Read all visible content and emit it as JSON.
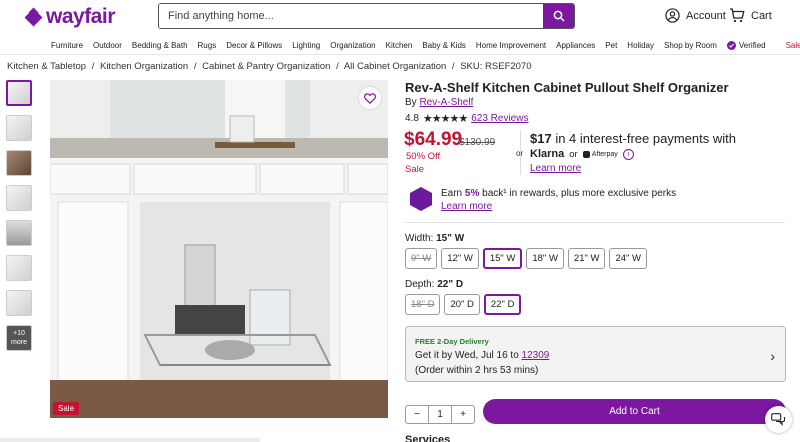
{
  "header": {
    "brand": "wayfair",
    "search_placeholder": "Find anything home...",
    "account_label": "Account",
    "cart_label": "Cart"
  },
  "nav": [
    "Furniture",
    "Outdoor",
    "Bedding & Bath",
    "Rugs",
    "Decor & Pillows",
    "Lighting",
    "Organization",
    "Kitchen",
    "Baby & Kids",
    "Home Improvement",
    "Appliances",
    "Pet",
    "Holiday",
    "Shop by Room"
  ],
  "nav_verified": "Verified",
  "nav_sale": "Sale",
  "breadcrumbs": [
    "Kitchen & Tabletop",
    "/",
    "Kitchen Organization",
    "/",
    "Cabinet & Pantry Organization",
    "/",
    "All Cabinet Organization",
    "/",
    "SKU: RSEF2070"
  ],
  "gallery": {
    "more_label": "+10 more",
    "sale_badge": "Sale"
  },
  "product": {
    "title": "Rev-A-Shelf Kitchen Cabinet Pullout Shelf Organizer",
    "by_prefix": "By",
    "brand": "Rev-A-Shelf",
    "rating": "4.8",
    "stars": "★★★★★",
    "reviews": "623 Reviews",
    "price": "$64.99",
    "old_price": "$130.99",
    "pct_off": "50% Off",
    "sale_label": "Sale",
    "or_label": "or",
    "installment_amount": "$17",
    "installment_text": " in 4 interest-free payments with",
    "klarna": "Klarna",
    "or2": "or",
    "afterpay": "Afterpay",
    "learn_more": "Learn more"
  },
  "rewards": {
    "earn": "Earn",
    "pct": "5%",
    "rest": " back¹ in rewards, plus more exclusive perks",
    "learn_more": "Learn more"
  },
  "width": {
    "label": "Width:",
    "value": "15\" W",
    "options": [
      "9\" W",
      "12\" W",
      "15\" W",
      "18\" W",
      "21\" W",
      "24\" W"
    ],
    "selected": "15\" W",
    "unavailable": [
      "9\" W"
    ]
  },
  "depth": {
    "label": "Depth:",
    "value": "22\" D",
    "options": [
      "18\" D",
      "20\" D",
      "22\" D"
    ],
    "selected": "22\" D",
    "unavailable": [
      "18\" D"
    ]
  },
  "delivery": {
    "tag": "FREE 2-Day Delivery",
    "line_prefix": "Get it by Wed, Jul 16 to ",
    "zip": "12309",
    "window": "(Order within 2 hrs 53 mins)"
  },
  "purchase": {
    "qty": "1",
    "minus": "−",
    "plus": "+",
    "add_to_cart": "Add to Cart"
  },
  "services_heading": "Services",
  "colors": {
    "brand_purple": "#7b189f",
    "sale_red": "#c41230"
  }
}
